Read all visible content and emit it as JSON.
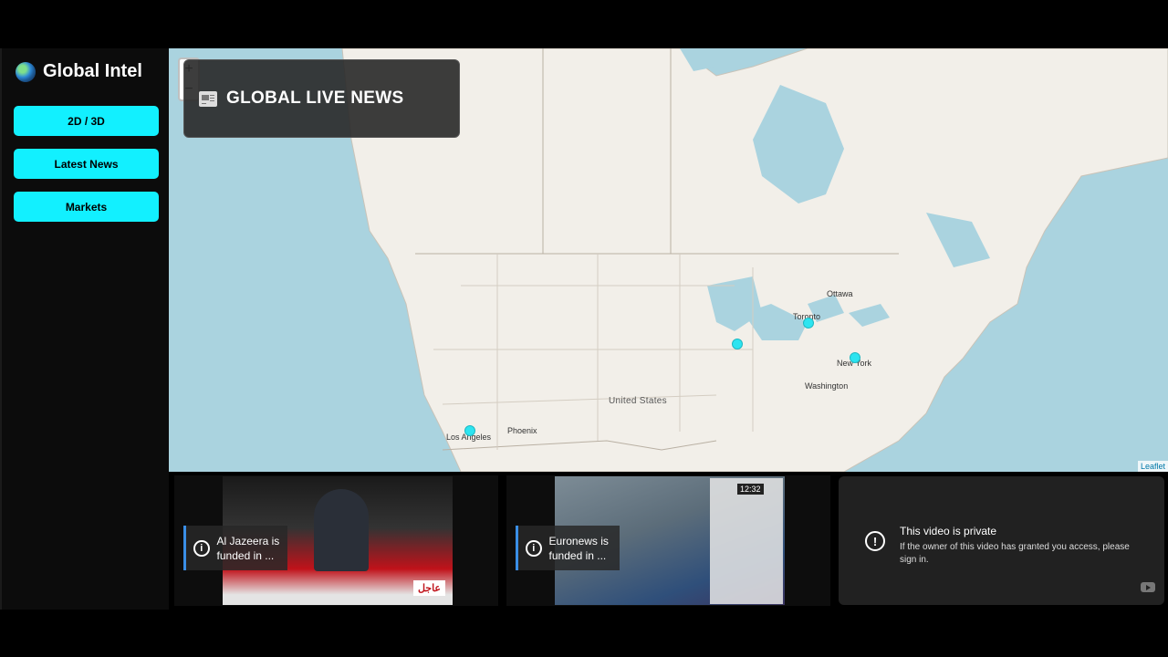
{
  "sidebar": {
    "brand_title": "Global Intel",
    "buttons": [
      {
        "label": "2D / 3D"
      },
      {
        "label": "Latest News"
      },
      {
        "label": "Markets"
      }
    ]
  },
  "map": {
    "panel_title": "GLOBAL LIVE NEWS",
    "zoom_in": "+",
    "zoom_out": "−",
    "country_label": "United States",
    "cities": [
      "Ottawa",
      "Toronto",
      "New York",
      "Washington",
      "Phoenix",
      "Los Angeles"
    ],
    "attribution": "Leaflet",
    "marker_color": "#2de4f0",
    "water_color": "#aad3df",
    "land_color": "#f2efe9"
  },
  "videos": [
    {
      "channel_note": "Al Jazeera is funded in ...",
      "overlay_badge": "عاجل"
    },
    {
      "channel_note": "Euronews is funded in ...",
      "overlay_badge": "12:32"
    }
  ],
  "private_video": {
    "title": "This video is private",
    "description": "If the owner of this video has granted you access, please sign in."
  },
  "colors": {
    "accent": "#12f0ff",
    "sidebar_bg": "#0c0c0c"
  }
}
